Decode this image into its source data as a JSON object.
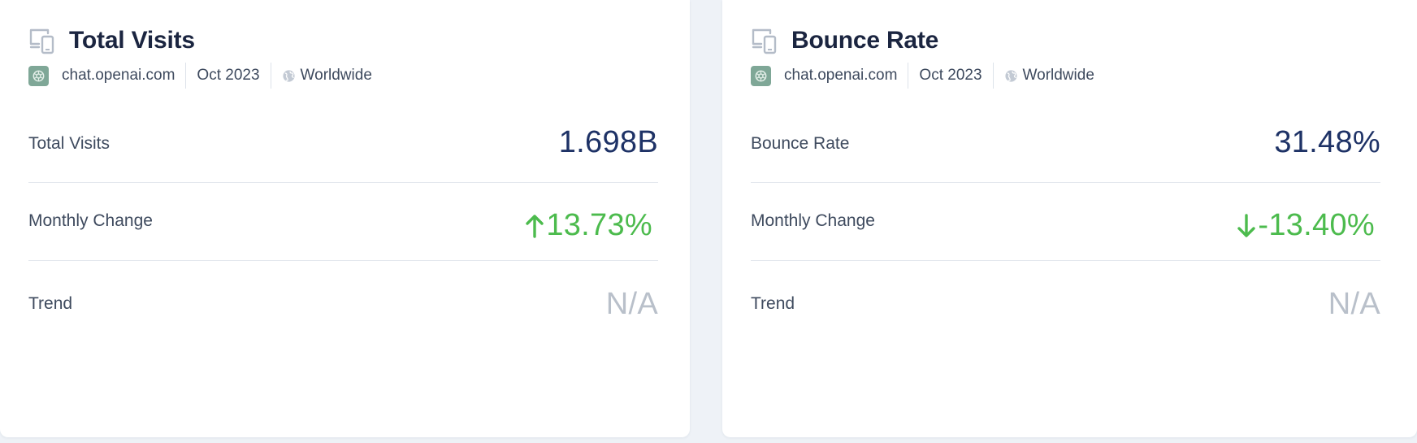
{
  "colors": {
    "title": "#1b2540",
    "value": "#1e3266",
    "change": "#4cbb4d",
    "na": "#b9c0ca",
    "label": "#3e4a5e",
    "background": "#eef2f7"
  },
  "cards": [
    {
      "icon": "devices-icon",
      "title": "Total Visits",
      "meta": {
        "site": "chat.openai.com",
        "site_icon": "openai-favicon",
        "period": "Oct 2023",
        "region_icon": "globe-icon",
        "region": "Worldwide"
      },
      "metrics": {
        "main": {
          "label": "Total Visits",
          "value": "1.698B"
        },
        "change": {
          "label": "Monthly Change",
          "value": "13.73%",
          "direction": "up",
          "arrow_icon": "arrow-up-icon"
        },
        "trend": {
          "label": "Trend",
          "value": "N/A"
        }
      }
    },
    {
      "icon": "devices-icon",
      "title": "Bounce Rate",
      "meta": {
        "site": "chat.openai.com",
        "site_icon": "openai-favicon",
        "period": "Oct 2023",
        "region_icon": "globe-icon",
        "region": "Worldwide"
      },
      "metrics": {
        "main": {
          "label": "Bounce Rate",
          "value": "31.48%"
        },
        "change": {
          "label": "Monthly Change",
          "value": "-13.40%",
          "direction": "down",
          "arrow_icon": "arrow-down-icon"
        },
        "trend": {
          "label": "Trend",
          "value": "N/A"
        }
      }
    }
  ]
}
